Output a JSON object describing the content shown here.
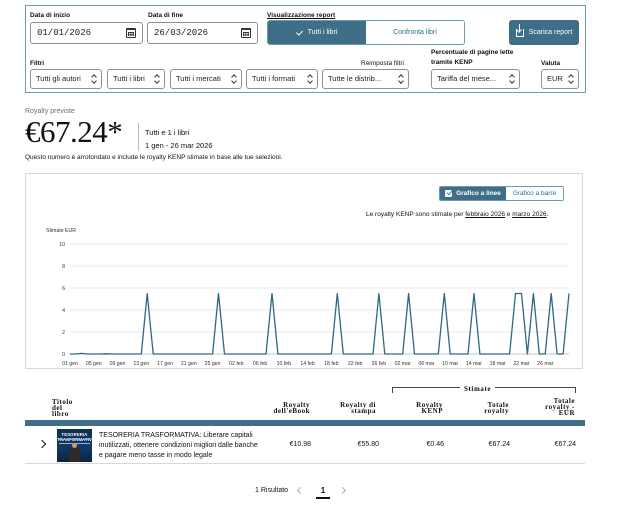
{
  "filters": {
    "start_date_label": "Data di inizio",
    "start_date_value": "01/01/2026",
    "end_date_label": "Data di fine",
    "end_date_value": "26/03/2026",
    "view_label": "Visualizzazione report",
    "view_all_label": "Tutti i libri",
    "view_compare_label": "Confronta libri",
    "download_label": "Scarica report",
    "filters_label": "Filtri",
    "reset_label": "Reimposta filtri",
    "kenp_pct_label_1": "Percentuale di pagine lette",
    "kenp_pct_label_2": "tramite KENP",
    "currency_label": "Valuta",
    "authors": "Tutti gli autori",
    "books": "Tutti i libri",
    "markets": "Tutti i mercati",
    "formats": "Tutti i formati",
    "distribution": "Tutte le distrib...",
    "kenp_rate": "Tariffa del mese...",
    "currency": "EUR"
  },
  "summary": {
    "caption": "Royalty previste",
    "amount": "€67.24*",
    "scope": "Tutti e 1 i libri",
    "range": "1 gen - 26 mar 2026",
    "note": "Questo numero è arrotondato e include le royalty KENP stimate in base alle tue selezioni."
  },
  "chart_toggle": {
    "line_label": "Grafico a linee",
    "bar_label": "Grafico a barre"
  },
  "kenp_note": {
    "prefix": "Le royalty KENP sono stimate per ",
    "month1": "febbraio 2026",
    "middle": " e ",
    "month2": "marzo 2026",
    "suffix": "."
  },
  "chart_data": {
    "type": "line",
    "ylabel": "Stimate EUR",
    "ylim": [
      0,
      10
    ],
    "y_ticks": [
      0,
      2,
      4,
      6,
      8,
      10
    ],
    "x_ticks": [
      "01 gen",
      "05 gen",
      "09 gen",
      "13 gen",
      "17 gen",
      "21 gen",
      "25 gen",
      "02 feb",
      "06 feb",
      "10 feb",
      "14 feb",
      "18 feb",
      "22 feb",
      "26 feb",
      "02 mar",
      "06 mar",
      "10 mar",
      "14 mar",
      "18 mar",
      "22 mar",
      "26 mar"
    ],
    "series": [
      {
        "color": "#2e6a86",
        "x": [
          0,
          1,
          2,
          3,
          4,
          5,
          6,
          7,
          8,
          9,
          10,
          11,
          12,
          13,
          14,
          15,
          16,
          17,
          18,
          19,
          20
        ],
        "y": [
          0,
          0.05,
          0,
          0.02,
          0,
          0,
          0,
          0,
          0,
          0,
          0,
          0,
          0,
          0,
          0,
          0,
          0,
          0,
          0,
          0,
          0
        ]
      }
    ],
    "spikes_note_points": [
      {
        "x": 13.0,
        "y": 5.5
      },
      {
        "x": 25.0,
        "y": 5.5
      },
      {
        "x": 34.0,
        "y": 5.5
      },
      {
        "x": 45.0,
        "y": 5.5
      },
      {
        "x": 52.0,
        "y": 5.5
      },
      {
        "x": 57.0,
        "y": 5.5
      },
      {
        "x": 63.0,
        "y": 5.5
      },
      {
        "x": 68.0,
        "y": 5.5
      },
      {
        "x": 75.0,
        "y": 5.5
      },
      {
        "x": 76.0,
        "y": 5.5
      },
      {
        "x": 78.0,
        "y": 5.5
      },
      {
        "x": 81.0,
        "y": 5.5
      },
      {
        "x": 84.0,
        "y": 5.5
      }
    ]
  },
  "table": {
    "stimate_label": "Stimate",
    "col_title": [
      "Titolo",
      "del",
      "libro"
    ],
    "col_ebook": [
      "Royalty",
      "dell'eBook"
    ],
    "col_print": [
      "Royalty di",
      "stampa"
    ],
    "col_kenp": [
      "Royalty",
      "KENP"
    ],
    "col_total": [
      "Totale",
      "royalty"
    ],
    "col_total_eur": [
      "Totale",
      "royalty -",
      "EUR"
    ],
    "rows": [
      {
        "cover_title": "TESORERIA",
        "cover_title2": "TRASFORMATIVA",
        "title": "TESORERIA TRASFORMATIVA: Liberare capitali inutilizzati, ottenere condizioni migliori dalle banche e pagare meno tasse in modo legale",
        "ebook": "€10.98",
        "print": "€55.80",
        "kenp": "€0.46",
        "total": "€67.24",
        "total_eur": "€67.24"
      }
    ]
  },
  "pagination": {
    "count": "1 Risultato",
    "page": "1"
  }
}
